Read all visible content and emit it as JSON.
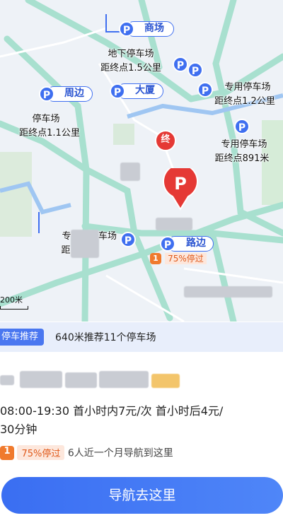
{
  "map": {
    "pins": {
      "shangchang": "商场",
      "zhoubian": "周边",
      "dasha": "大厦",
      "lubian": "路边",
      "p": "P"
    },
    "labels": {
      "dixia_name": "地下停车场",
      "dixia_dist": "距终点1.5公里",
      "zhoubian_name": "停车场",
      "zhoubian_dist": "距终点1.1公里",
      "zhuanyong1_name": "专用停车场",
      "zhuanyong1_dist": "距终点1.2公里",
      "zhuanyong2_name": "专用停车场",
      "zhuanyong2_dist": "距终点891米",
      "partial_name": "专",
      "partial_name_tail": "车场",
      "partial_dist": "距"
    },
    "destination_marker": "终",
    "selected_marker": "P",
    "lubian_stat_num": "1",
    "lubian_stat_text": "75%停过",
    "scale_text": "200米"
  },
  "recommend": {
    "badge": "停车推荐",
    "text": "640米推荐11个停车场"
  },
  "detail": {
    "price_line1": "08:00-19:30 首小时内7元/次 首小时后4元/",
    "price_line2": "30分钟",
    "rank_num": "1",
    "percent_tag": "75%停过",
    "nav_count": "6人近一个月导航到这里"
  },
  "actions": {
    "navigate": "导航去这里"
  },
  "colors": {
    "accent": "#3f6ff0",
    "road": "#a8e0cf",
    "water": "#9fc6f2",
    "marker_red": "#e53935"
  }
}
